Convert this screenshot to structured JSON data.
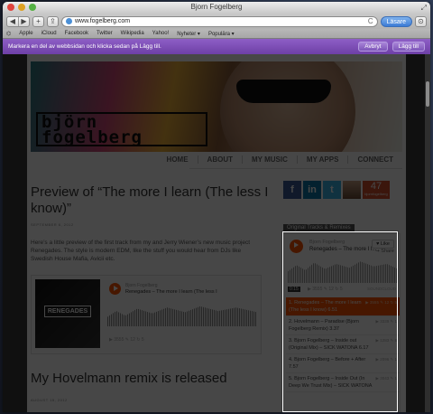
{
  "window": {
    "title": "Bjorn Fogelberg"
  },
  "toolbar": {
    "url": "www.fogelberg.com",
    "reader_label": "Läsare",
    "reload_glyph": "C"
  },
  "bookmarks": [
    "Apple",
    "iCloud",
    "Facebook",
    "Twitter",
    "Wikipedia",
    "Yahoo!",
    "Nyheter",
    "Populära"
  ],
  "clip": {
    "message": "Markera en del av webbsidan och klicka sedan på Lägg till.",
    "cancel_label": "Avbryt",
    "add_label": "Lägg till"
  },
  "site": {
    "logo_text": "björn fogelberg",
    "nav": [
      "HOME",
      "ABOUT",
      "MY MUSIC",
      "MY APPS",
      "CONNECT"
    ],
    "post1": {
      "title": "Preview of “The more I learn (The less I know)”",
      "date": "SEPTEMBER 6, 2012",
      "text": "Here’s a little preview of the first track from my and Jerry Wiener’s new music project Renegades. The style is modern EDM, like the stuff you would hear from DJs like Swedish House Mafia, Avicii etc.",
      "embed": {
        "cover_text": "RENEGADES",
        "artist": "Bjorn Fogelberg",
        "track": "Renegades – The more I learn (The less I",
        "stats": "▶ 3555  ✎ 12  ↻ 5"
      }
    },
    "post2": {
      "title": "My Hovelmann remix is released",
      "date": "AUGUST 15, 2012"
    },
    "social": {
      "fb": "f",
      "li": "in",
      "tw": "t",
      "count": "47",
      "count_caption": "bjornfogelberg"
    },
    "sidebar": {
      "heading": "Original Tracks & Remixes",
      "player": {
        "artist": "Bjorn Fogelberg",
        "track": "Renegades – The more I l...",
        "like_label": "♥ Like",
        "share_label": "↪ Share",
        "time": "0:15",
        "stats": "▶ 3555  ✎ 12  ↻ 5",
        "brand": "SOUNDCLOUD"
      },
      "tracks": [
        {
          "title": "1. Renegades – The more I learn (The less I know) 6.51",
          "meta": "▶ 3555  ✎ 12  ↻ 5"
        },
        {
          "title": "2. Hovelmann – Paradise (Bjorn Fogelberg Remix) 3.37",
          "meta": "▶ 3339  ✎ 1"
        },
        {
          "title": "3. Bjorn Fogelberg – Inside out (Original Mix) – SICK WATONA 6.17",
          "meta": "▶ 1283  ✎ 8"
        },
        {
          "title": "4. Bjorn Fogelberg – Before + After 7.57",
          "meta": "▶ 2096  ✎ 1"
        },
        {
          "title": "5. Bjorn Fogelberg – Inside Out (In Deep We Trust Mix) – SICK WATONA",
          "meta": "▶ 3043  ✎ 1"
        }
      ]
    }
  }
}
